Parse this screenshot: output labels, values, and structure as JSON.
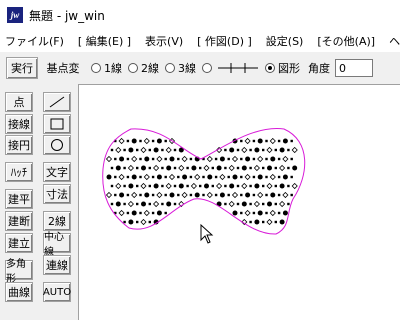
{
  "window": {
    "title": "無題 - jw_win",
    "app_icon": "jw"
  },
  "menu": [
    "ファイル(F)",
    "[ 編集(E) ]",
    "表示(V)",
    "[ 作図(D) ]",
    "設定(S)",
    "[その他(A)]",
    "ヘルプ"
  ],
  "toolbar": {
    "execute": "実行",
    "base_change": "基点変",
    "radio_options": [
      "1線",
      "2線",
      "3線"
    ],
    "figure_label": "図形",
    "selected_option": "図形",
    "angle_label": "角度",
    "angle_value": "0"
  },
  "tools": {
    "ten": "点",
    "setsusen": "接線",
    "setsuen": "接円",
    "hatch": "ﾊｯﾁ",
    "moji": "文字",
    "sunpo": "寸法",
    "kenhei": "建平",
    "kendan": "建断",
    "niisen": "2線",
    "kenritsu": "建立",
    "chushinsen": "中心線",
    "tasen": "多角形",
    "renSen": "連線",
    "kyokusen": "曲線",
    "auto": "AUTO"
  },
  "colors": {
    "boundary": "#d81bd8",
    "hatch_symbols": "#000000",
    "canvas_bg": "#ffffff",
    "panel_bg": "#f0f0f0"
  },
  "icons": {
    "line_tool": "line-icon",
    "rect_tool": "rectangle-icon",
    "circle_tool": "circle-icon",
    "cursor": "mouse-pointer-icon"
  }
}
